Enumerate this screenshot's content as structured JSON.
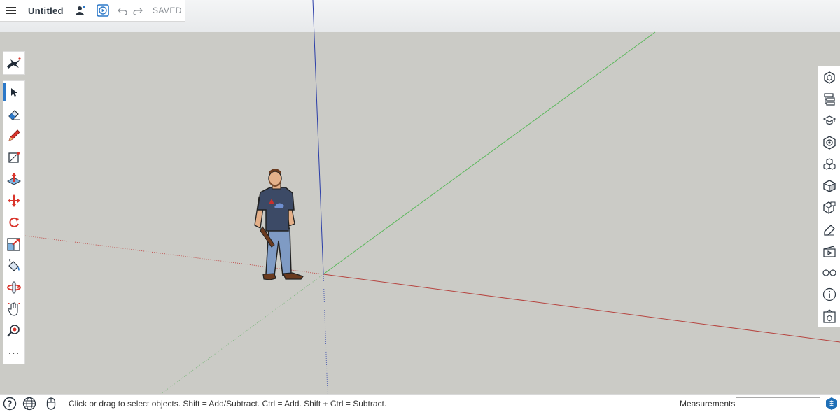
{
  "app": {
    "document_title": "Untitled",
    "save_state": "SAVED"
  },
  "toolbar": {
    "menu_icon": "hamburger-menu-icon",
    "profile_icon": "user-add-icon",
    "present_icon": "play-icon",
    "undo_icon": "undo-icon",
    "redo_icon": "redo-icon"
  },
  "left_tools": [
    {
      "id": "select",
      "icon": "select-arrow-icon",
      "active": true
    },
    {
      "id": "eraser",
      "icon": "eraser-icon"
    },
    {
      "id": "pencil",
      "icon": "pencil-icon"
    },
    {
      "id": "rectangle",
      "icon": "rectangle-icon"
    },
    {
      "id": "push-pull",
      "icon": "push-pull-icon"
    },
    {
      "id": "move",
      "icon": "move-icon"
    },
    {
      "id": "rotate",
      "icon": "rotate-icon"
    },
    {
      "id": "scale",
      "icon": "scale-icon"
    },
    {
      "id": "paint",
      "icon": "paint-bucket-icon"
    },
    {
      "id": "orbit",
      "icon": "orbit-icon"
    },
    {
      "id": "pan",
      "icon": "pan-hand-icon"
    },
    {
      "id": "zoom-extents",
      "icon": "zoom-icon"
    }
  ],
  "left_more": "···",
  "right_panels": [
    "entity-info-icon",
    "outliner-icon",
    "instructor-icon",
    "components-icon",
    "materials-icon",
    "styles-icon",
    "scenes-icon",
    "tags-icon",
    "animation-icon",
    "display-icon",
    "info-icon",
    "3d-warehouse-icon"
  ],
  "status": {
    "help_icon": "help-icon",
    "globe_icon": "globe-icon",
    "mouse_icon": "mouse-icon",
    "message": "Click or drag to select objects. Shift = Add/Subtract. Ctrl = Add. Shift + Ctrl = Subtract.",
    "measurements_label": "Measurements",
    "measurements_value": ""
  },
  "colors": {
    "axis_red": "#c0504d",
    "axis_green": "#5cb85c",
    "axis_blue": "#2b3ea8",
    "ground": "#cbcbc6",
    "accent": "#2c78c8"
  }
}
